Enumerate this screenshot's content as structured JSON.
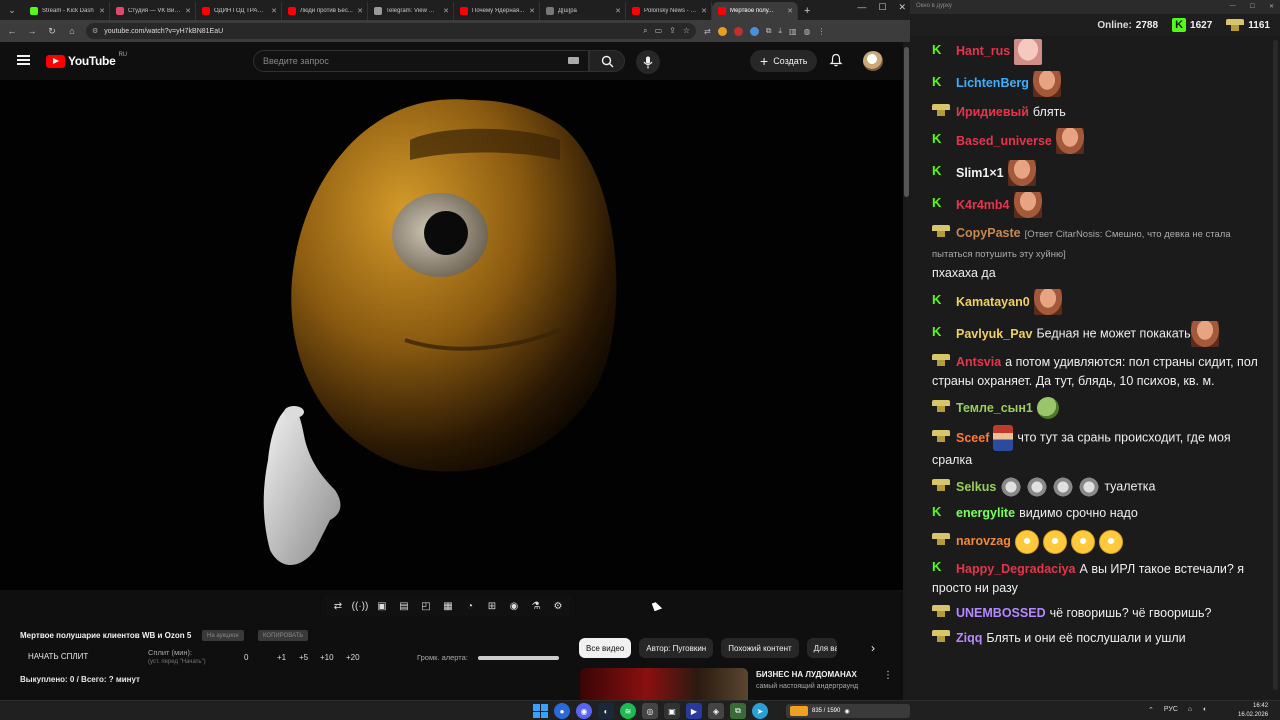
{
  "browser": {
    "tabs": [
      {
        "label": "Stream - Kick Dash",
        "color": "#53fc18"
      },
      {
        "label": "Студия — VK Видео",
        "color": "#e04a6a"
      },
      {
        "label": "ОДИН ГОД ТРАМПА",
        "color": "#ff0000"
      },
      {
        "label": "Люди против Бес...",
        "color": "#ff0000"
      },
      {
        "label": "Telegram: View @...",
        "color": "#999999"
      },
      {
        "label": "Почему Ядерная...",
        "color": "#ff0000"
      },
      {
        "label": "Д[ш]ра",
        "color": "#777777"
      },
      {
        "label": "Polonsky News - Y...",
        "color": "#ff0000"
      },
      {
        "label": "Мертвое полу...",
        "color": "#ff0000",
        "active": true
      }
    ],
    "url": "youtube.com/watch?v=yH7kBN81EaU"
  },
  "youtube": {
    "logo_text": "YouTube",
    "logo_region": "RU",
    "search_placeholder": "Введите запрос",
    "create_label": "Создать"
  },
  "extension": {
    "video_title": "Мертвое полушарие клиентов WB и Ozon 5",
    "pill_1": "На аукцион",
    "pill_2": "КОПИРОВАТЬ",
    "start_split": "НАЧАТЬ СПЛИТ",
    "split_label": "Сплит (мин):",
    "split_hint": "(уст. перед \"Начать\")",
    "split_value": "0",
    "split_increments": [
      "+1",
      "+5",
      "+10",
      "+20"
    ],
    "alert_volume_label": "Громк. алерта:",
    "bought_text": "Выкуплено: 0 / Всего: ? минут"
  },
  "recommendations": {
    "chips": [
      "Все видео",
      "Автор: Пуговкин",
      "Похожий контент",
      "Для ва"
    ],
    "next_icon": "chevron-right-icon",
    "item": {
      "title": "БИЗНЕС НА ЛУДОМАНАХ",
      "desc": "самый настоящий андерграунд"
    }
  },
  "chat": {
    "window_title": "Окно в дурку",
    "online_label": "Online:",
    "online_count": "2788",
    "kick_count": "1627",
    "twitch_count": "1161",
    "messages": [
      {
        "platform": "kick",
        "nick": "Hant_rus",
        "color": "#e8344b",
        "text": "",
        "emotes": [
          "face-pink"
        ]
      },
      {
        "platform": "kick",
        "nick": "LichtenBerg",
        "color": "#3cb0ff",
        "text": "",
        "emotes": [
          "face"
        ]
      },
      {
        "platform": "twitch",
        "nick": "Иридиевый",
        "color": "#e8344b",
        "text": "блять",
        "emotes": []
      },
      {
        "platform": "kick",
        "nick": "Based_universe",
        "color": "#e8344b",
        "text": "",
        "emotes": [
          "face"
        ]
      },
      {
        "platform": "kick",
        "nick": "Slim1×1",
        "color": "#f1f1f1",
        "text": "",
        "emotes": [
          "face"
        ]
      },
      {
        "platform": "kick",
        "nick": "K4r4mb4",
        "color": "#e8344b",
        "text": "",
        "emotes": [
          "face"
        ]
      },
      {
        "platform": "twitch",
        "nick": "CopyPaste",
        "color": "#c8884e",
        "reply": "[Ответ CitarNosis: Смешно, что девка не стала пытаться потушить эту хуйню]",
        "text": "пхахаха да",
        "emotes": []
      },
      {
        "platform": "kick",
        "nick": "Kamatayan0",
        "color": "#f0d060",
        "text": "",
        "emotes": [
          "face"
        ]
      },
      {
        "platform": "kick",
        "nick": "Pavlyuk_Pav",
        "color": "#f0d060",
        "text": "Бедная не может покакать",
        "emotes": [
          "face"
        ]
      },
      {
        "platform": "twitch",
        "nick": "Antsvia",
        "color": "#e8344b",
        "text": "а потом удивляются: пол страны сидит, пол страны охраняет. Да тут, блядь, 10 психов, кв. м.",
        "emotes": []
      },
      {
        "platform": "twitch",
        "nick": "Темле_сын1",
        "color": "#9acd5a",
        "text": "",
        "emotes": [
          "pepe"
        ]
      },
      {
        "platform": "twitch",
        "nick": "Sceef",
        "color": "#ff7a2e",
        "text": "что тут за срань происходит, где моя сралка",
        "emotes": [
          "mario"
        ]
      },
      {
        "platform": "twitch",
        "nick": "Selkus",
        "color": "#9acd5a",
        "text": "туалетка",
        "emotes": [
          "cat",
          "cat",
          "cat",
          "cat"
        ]
      },
      {
        "platform": "kick",
        "nick": "energylite",
        "color": "#7cff5a",
        "text": "видимо срочно надо",
        "emotes": []
      },
      {
        "platform": "twitch",
        "nick": "narovzag",
        "color": "#f08a3a",
        "text": "",
        "emotes": [
          "lol",
          "lol",
          "lol",
          "lol"
        ]
      },
      {
        "platform": "kick",
        "nick": "Happy_Degradaciya",
        "color": "#e8344b",
        "text": "А вы ИРЛ такое встечали? я просто ни разу",
        "emotes": []
      },
      {
        "platform": "twitch",
        "nick": "UNEMBOSSED",
        "color": "#b58aff",
        "text": "чё говоришь? чё гвооришь?",
        "emotes": []
      },
      {
        "platform": "twitch",
        "nick": "Ziqq",
        "color": "#b58aff",
        "text": "Блять и они её послушали и ушли",
        "emotes": []
      }
    ]
  },
  "taskbar": {
    "game_label": "835 / 1590",
    "tray_lang": "РУС",
    "time": "16:42",
    "date": "16.02.2026"
  }
}
